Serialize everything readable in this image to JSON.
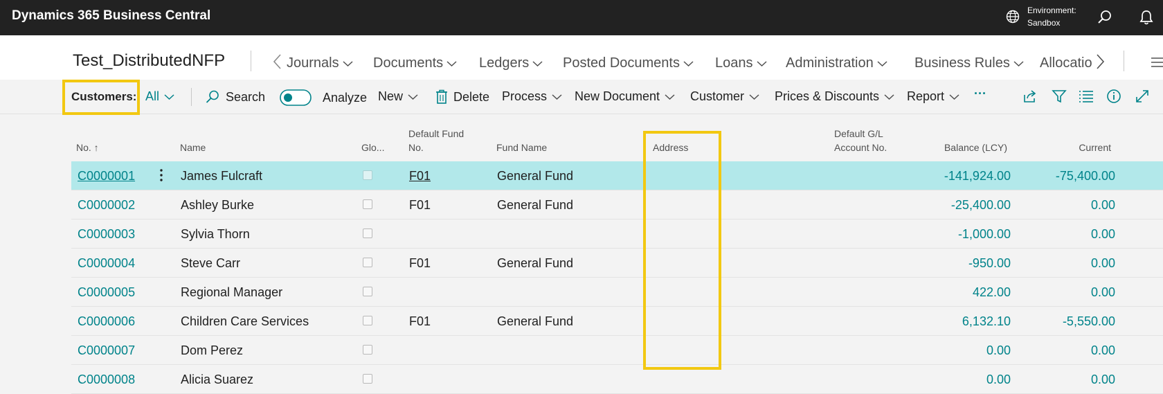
{
  "app": {
    "title": "Dynamics 365 Business Central"
  },
  "environment": {
    "label": "Environment:",
    "value": "Sandbox"
  },
  "icons": {
    "globe": "globe-icon",
    "search": "search-icon",
    "bell": "bell-icon"
  },
  "nav": {
    "company": "Test_DistributedNFP",
    "items": [
      "Journals",
      "Documents",
      "Ledgers",
      "Posted Documents",
      "Loans",
      "Administration",
      "Business Rules",
      "Allocatio"
    ]
  },
  "toolbar": {
    "page_caption": "Customers:",
    "view": "All",
    "search": "Search",
    "analyze": "Analyze",
    "new": "New",
    "delete": "Delete",
    "process": "Process",
    "new_document": "New Document",
    "customer": "Customer",
    "prices_discounts": "Prices & Discounts",
    "report": "Report",
    "more": "···"
  },
  "columns": {
    "no": "No. ↑",
    "name": "Name",
    "glo": "Glo...",
    "default_fund_no_1": "Default Fund",
    "default_fund_no_2": "No.",
    "fund_name": "Fund Name",
    "address": "Address",
    "default_gl_1": "Default G/L",
    "default_gl_2": "Account No.",
    "balance": "Balance (LCY)",
    "current": "Current"
  },
  "rows": [
    {
      "no": "C0000001",
      "name": "James Fulcraft",
      "fund_no": "F01",
      "fund_name": "General Fund",
      "balance": "-141,924.00",
      "current": "-75,400.00"
    },
    {
      "no": "C0000002",
      "name": "Ashley Burke",
      "fund_no": "F01",
      "fund_name": "General Fund",
      "balance": "-25,400.00",
      "current": "0.00"
    },
    {
      "no": "C0000003",
      "name": "Sylvia Thorn",
      "fund_no": "",
      "fund_name": "",
      "balance": "-1,000.00",
      "current": "0.00"
    },
    {
      "no": "C0000004",
      "name": "Steve Carr",
      "fund_no": "F01",
      "fund_name": "General Fund",
      "balance": "-950.00",
      "current": "0.00"
    },
    {
      "no": "C0000005",
      "name": "Regional Manager",
      "fund_no": "",
      "fund_name": "",
      "balance": "422.00",
      "current": "0.00"
    },
    {
      "no": "C0000006",
      "name": "Children Care Services",
      "fund_no": "F01",
      "fund_name": "General Fund",
      "balance": "6,132.10",
      "current": "-5,550.00"
    },
    {
      "no": "C0000007",
      "name": "Dom Perez",
      "fund_no": "",
      "fund_name": "",
      "balance": "0.00",
      "current": "0.00"
    },
    {
      "no": "C0000008",
      "name": "Alicia Suarez",
      "fund_no": "",
      "fund_name": "",
      "balance": "0.00",
      "current": "0.00"
    }
  ],
  "colors": {
    "accent": "#00838a",
    "highlight": "#f2c811",
    "selected_row": "#b2e8ea",
    "topbar": "#222222"
  }
}
